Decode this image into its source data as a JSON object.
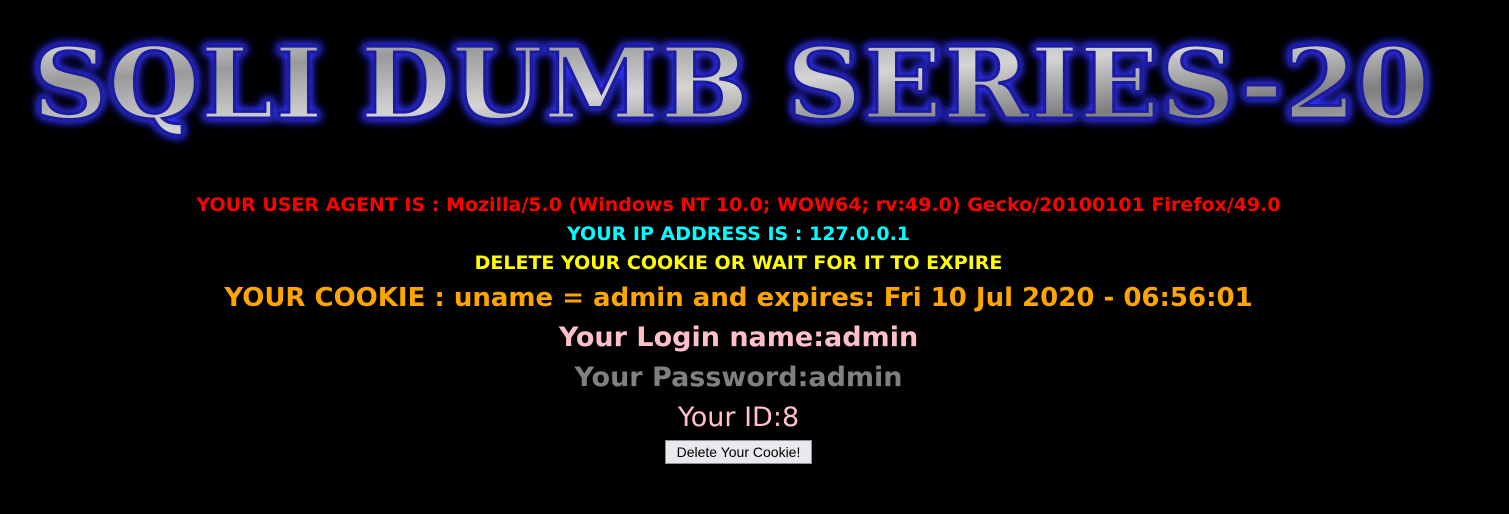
{
  "banner": {
    "title": "SQLI DUMB SERIES-20"
  },
  "info": {
    "user_agent": "YOUR USER AGENT IS : Mozilla/5.0 (Windows NT 10.0; WOW64; rv:49.0) Gecko/20100101 Firefox/49.0",
    "ip_address": "YOUR IP ADDRESS IS : 127.0.0.1",
    "delete_notice": "DELETE YOUR COOKIE OR WAIT FOR IT TO EXPIRE",
    "cookie": "YOUR COOKIE : uname = admin and expires: Fri 10 Jul 2020 - 06:56:01",
    "login_name": "Your Login name:admin",
    "password": "Your Password:admin",
    "id": "Your ID:8"
  },
  "form": {
    "delete_button_label": "Delete Your Cookie!"
  },
  "colors": {
    "background": "#000000",
    "user_agent": "#ff0000",
    "ip_address": "#00ffff",
    "delete_notice": "#ffff00",
    "cookie": "#ffa500",
    "login_name": "#ffc0cb",
    "password": "#808080",
    "id": "#ffc0cb"
  }
}
